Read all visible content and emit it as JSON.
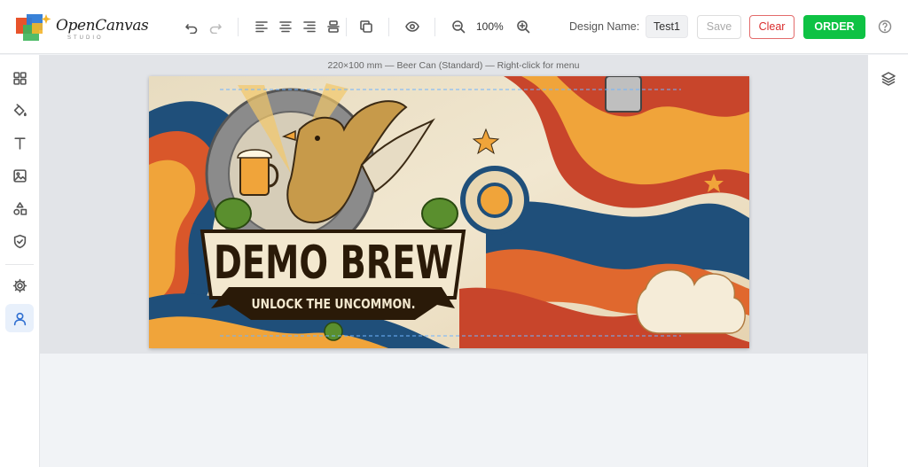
{
  "app": {
    "logo_name": "OpenCanvas",
    "logo_sub": "STUDIO"
  },
  "toolbar": {
    "zoom": "100%",
    "design_name_label": "Design Name:",
    "design_name_value": "Test1",
    "save_label": "Save",
    "clear_label": "Clear",
    "order_label": "ORDER",
    "icons": [
      "undo-icon",
      "redo-icon",
      "align-left-icon",
      "align-center-icon",
      "align-right-icon",
      "align-vertical-icon",
      "duplicate-icon",
      "preview-eye-icon",
      "zoom-out-icon",
      "zoom-in-icon",
      "help-icon"
    ]
  },
  "sidebar": {
    "items": [
      "templates-icon",
      "fill-bucket-icon",
      "text-icon",
      "image-icon",
      "shapes-icon",
      "shield-icon",
      "settings-gear-icon",
      "user-icon"
    ],
    "active": "user-icon"
  },
  "rightbar": {
    "items": [
      "layers-icon"
    ]
  },
  "canvas": {
    "caption": "220×100 mm — Beer Can (Standard) — Right-click for menu",
    "artwork": {
      "headline": "DEMO BREW",
      "tagline": "UNLOCK THE UNCOMMON."
    }
  },
  "colors": {
    "order_green": "#0ec244",
    "clear_red": "#d92c2c",
    "active_blue": "#2f6fd1"
  }
}
